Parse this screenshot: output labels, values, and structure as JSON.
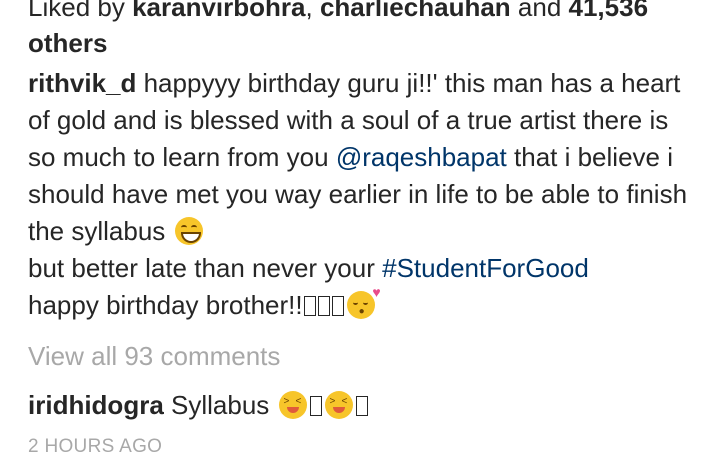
{
  "likes": {
    "prefix": "Liked by ",
    "user1": "karanvirbohra",
    "separator": ", ",
    "user2": "charliechauhan",
    "connector": " and ",
    "count": "41,536",
    "suffix": "others"
  },
  "caption": {
    "username": "rithvik_d",
    "text_part1": " happyyy birthday guru ji!!' this man has a heart of gold and is blessed with a soul of a true artist there is so much to learn from you ",
    "mention": "@raqeshbapat",
    "text_part2": " that i believe i should have met you way earlier in life to be able to finish the syllabus ",
    "text_part3": " but better late than never your ",
    "hashtag": "#StudentForGood",
    "text_part4": " happy birthday brother!!"
  },
  "view_all_comments": "View all 93 comments",
  "comment": {
    "username": "iridhidogra",
    "text": " Syllabus "
  },
  "timestamp": "2 HOURS AGO",
  "icons": {
    "grin_emoji": "grinning-face-with-smiling-eyes",
    "kiss_emoji": "face-throwing-a-kiss",
    "laugh_emoji": "laughing-face",
    "missing_glyph": "missing-glyph-box"
  },
  "colors": {
    "text": "#262626",
    "link": "#003569",
    "muted": "#a8a8a8"
  }
}
